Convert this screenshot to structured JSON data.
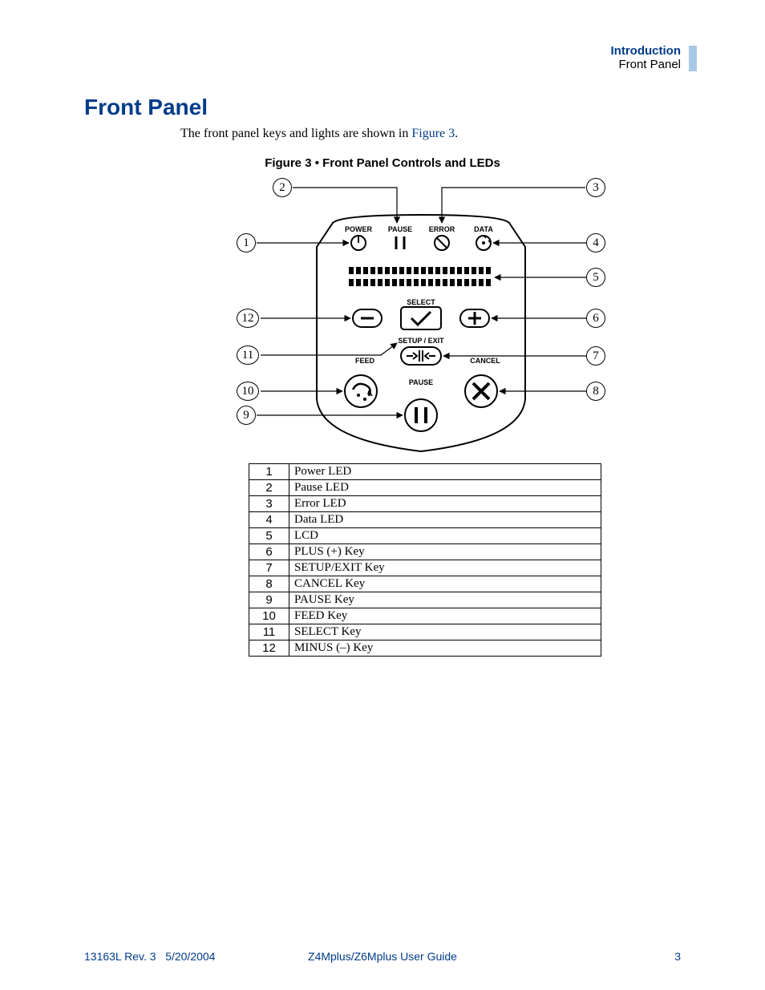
{
  "header": {
    "chapter": "Introduction",
    "section": "Front Panel"
  },
  "page": {
    "title": "Front Panel",
    "intro_prefix": "The front panel keys and lights are shown in ",
    "intro_link": "Figure 3",
    "intro_suffix": ".",
    "figure_caption": "Figure 3 • Front Panel Controls and LEDs"
  },
  "diagram": {
    "led_labels": [
      "POWER",
      "PAUSE",
      "ERROR",
      "DATA"
    ],
    "key_labels": {
      "select": "SELECT",
      "setup_exit": "SETUP / EXIT",
      "feed": "FEED",
      "cancel": "CANCEL",
      "pause": "PAUSE"
    },
    "callouts": {
      "c1": "1",
      "c2": "2",
      "c3": "3",
      "c4": "4",
      "c5": "5",
      "c6": "6",
      "c7": "7",
      "c8": "8",
      "c9": "9",
      "c10": "10",
      "c11": "11",
      "c12": "12"
    }
  },
  "legend": [
    {
      "n": "1",
      "d": "Power LED"
    },
    {
      "n": "2",
      "d": "Pause LED"
    },
    {
      "n": "3",
      "d": "Error LED"
    },
    {
      "n": "4",
      "d": "Data LED"
    },
    {
      "n": "5",
      "d": "LCD"
    },
    {
      "n": "6",
      "d": "PLUS (+) Key"
    },
    {
      "n": "7",
      "d": "SETUP/EXIT Key"
    },
    {
      "n": "8",
      "d": "CANCEL Key"
    },
    {
      "n": "9",
      "d": "PAUSE Key"
    },
    {
      "n": "10",
      "d": "FEED Key"
    },
    {
      "n": "11",
      "d": "SELECT Key"
    },
    {
      "n": "12",
      "d": "MINUS (–) Key"
    }
  ],
  "footer": {
    "rev": "13163L Rev. 3",
    "date": "5/20/2004",
    "doc_title": "Z4Mplus/Z6Mplus User Guide",
    "page_number": "3"
  }
}
